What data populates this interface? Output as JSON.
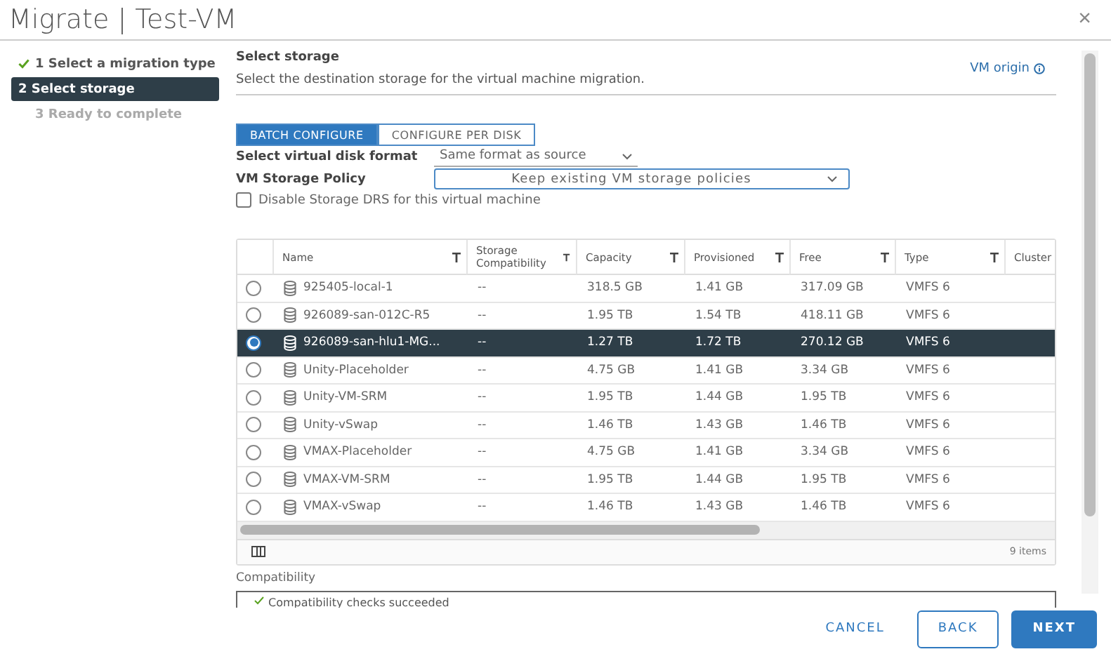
{
  "window": {
    "title": "Migrate | Test-VM",
    "close": "×"
  },
  "steps": [
    {
      "label": "1 Select a migration type",
      "selected": false,
      "completed": true,
      "disabled": false
    },
    {
      "label": "2 Select storage",
      "selected": true,
      "completed": false,
      "disabled": false
    },
    {
      "label": "3 Ready to complete",
      "selected": false,
      "completed": false,
      "disabled": true
    }
  ],
  "page": {
    "title": "Select storage",
    "description": "Select the destination storage for the virtual machine migration.",
    "link": "VM origin"
  },
  "config_tabs": [
    {
      "label": "BATCH CONFIGURE",
      "selected": true
    },
    {
      "label": "CONFIGURE PER DISK",
      "selected": false
    }
  ],
  "disk_format": {
    "label": "Select virtual disk format",
    "value": "Same format as source"
  },
  "storage_policy": {
    "label": "VM Storage Policy",
    "value": "Keep existing VM storage policies"
  },
  "disable_drs": {
    "label": "Disable Storage DRS for this virtual machine",
    "checked": false
  },
  "table": {
    "columns": [
      {
        "label": "Name",
        "filter": true
      },
      {
        "label": "Storage Compatibility",
        "filter": true
      },
      {
        "label": "Capacity",
        "filter": true
      },
      {
        "label": "Provisioned",
        "filter": true
      },
      {
        "label": "Free",
        "filter": true
      },
      {
        "label": "Type",
        "filter": true
      },
      {
        "label": "Cluster",
        "filter": false
      }
    ],
    "rows": [
      {
        "selected": false,
        "cells": [
          "925405-local-1",
          "--",
          "318.5 GB",
          "1.41 GB",
          "317.09 GB",
          "VMFS 6"
        ]
      },
      {
        "selected": false,
        "cells": [
          "926089-san-012C-R5",
          "--",
          "1.95 TB",
          "1.54 TB",
          "418.11 GB",
          "VMFS 6"
        ]
      },
      {
        "selected": true,
        "cells": [
          "926089-san-hlu1-MG...",
          "--",
          "1.27 TB",
          "1.72 TB",
          "270.12 GB",
          "VMFS 6"
        ]
      },
      {
        "selected": false,
        "cells": [
          "Unity-Placeholder",
          "--",
          "4.75 GB",
          "1.41 GB",
          "3.34 GB",
          "VMFS 6"
        ]
      },
      {
        "selected": false,
        "cells": [
          "Unity-VM-SRM",
          "--",
          "1.95 TB",
          "1.44 GB",
          "1.95 TB",
          "VMFS 6"
        ]
      },
      {
        "selected": false,
        "cells": [
          "Unity-vSwap",
          "--",
          "1.46 TB",
          "1.43 GB",
          "1.46 TB",
          "VMFS 6"
        ]
      },
      {
        "selected": false,
        "cells": [
          "VMAX-Placeholder",
          "--",
          "4.75 GB",
          "1.41 GB",
          "3.34 GB",
          "VMFS 6"
        ]
      },
      {
        "selected": false,
        "cells": [
          "VMAX-VM-SRM",
          "--",
          "1.95 TB",
          "1.44 GB",
          "1.95 TB",
          "VMFS 6"
        ]
      },
      {
        "selected": false,
        "cells": [
          "VMAX-vSwap",
          "--",
          "1.46 TB",
          "1.43 GB",
          "1.46 TB",
          "VMFS 6"
        ]
      }
    ],
    "count": "9 items"
  },
  "compatibility": {
    "label": "Compatibility",
    "message": "Compatibility checks succeeded"
  },
  "buttons": [
    {
      "label": "CANCEL",
      "kind": "link"
    },
    {
      "label": "BACK",
      "kind": "outline"
    },
    {
      "label": "NEXT",
      "kind": "primary"
    }
  ]
}
